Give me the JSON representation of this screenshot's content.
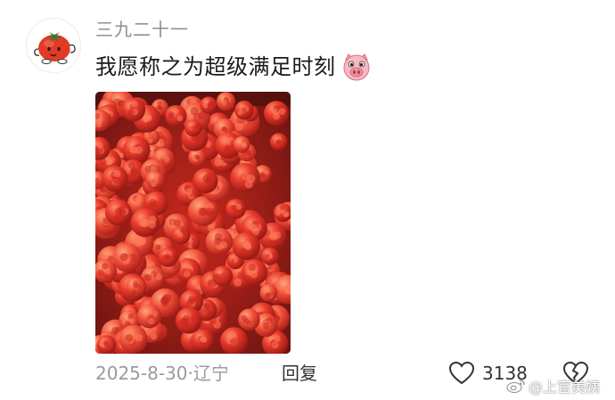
{
  "comment": {
    "username": "三九二十一",
    "text": "我愿称之为超级满足时刻",
    "emoji": "pig-face-icon",
    "image_alt": "raspberries-photo"
  },
  "footer": {
    "date_location": "2025-8-30·辽宁",
    "reply_label": "回复",
    "like_count": "3138"
  },
  "watermark": {
    "text": "@上官美姨"
  },
  "colors": {
    "username": "#8f8f8f",
    "text": "#1a1a1a",
    "meta": "#9a9a9a",
    "berry": "#e0352b"
  }
}
